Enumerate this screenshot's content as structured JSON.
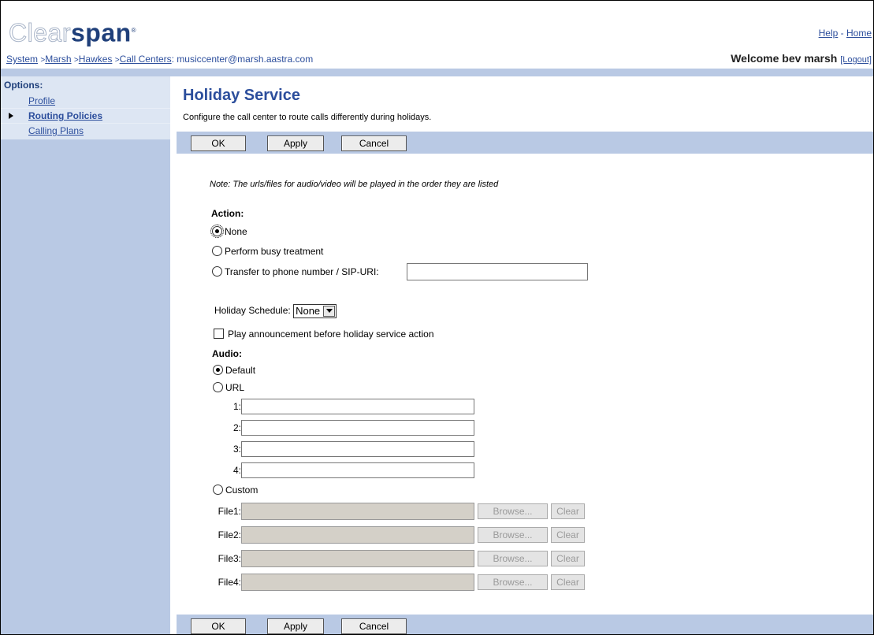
{
  "header": {
    "logo_light": "Clear",
    "logo_bold": "span",
    "logo_mark": "®",
    "help": "Help",
    "home": "Home",
    "dash": "-"
  },
  "breadcrumb": {
    "system": "System",
    "marsh": "Marsh",
    "hawkes": "Hawkes",
    "call_centers": "Call Centers",
    "context": ": musiccenter@marsh.aastra.com"
  },
  "welcome": {
    "text": "Welcome bev marsh",
    "logout": "[Logout]"
  },
  "sidebar": {
    "title": "Options:",
    "items": [
      {
        "label": "Profile",
        "selected": false
      },
      {
        "label": "Routing Policies",
        "selected": true
      },
      {
        "label": "Calling Plans",
        "selected": false
      }
    ]
  },
  "page": {
    "title": "Holiday Service",
    "description": "Configure the call center to route calls differently during holidays."
  },
  "buttons": {
    "ok": "OK",
    "apply": "Apply",
    "cancel": "Cancel"
  },
  "form": {
    "note": "Note: The urls/files for audio/video will be played in the order they are listed",
    "action_label": "Action:",
    "action_options": [
      "None",
      "Perform busy treatment",
      "Transfer to phone number / SIP-URI:"
    ],
    "action_selected": "None",
    "transfer_value": "",
    "holiday_schedule_label": "Holiday Schedule:",
    "holiday_schedule_value": "None",
    "play_announcement_label": "Play announcement before holiday service action",
    "play_announcement_checked": false,
    "audio_label": "Audio:",
    "audio_options": [
      "Default",
      "URL",
      "Custom"
    ],
    "audio_selected": "Default",
    "url_labels": [
      "1:",
      "2:",
      "3:",
      "4:"
    ],
    "file_labels": [
      "File1:",
      "File2:",
      "File3:",
      "File4:"
    ],
    "browse_label": "Browse...",
    "clear_label": "Clear"
  }
}
